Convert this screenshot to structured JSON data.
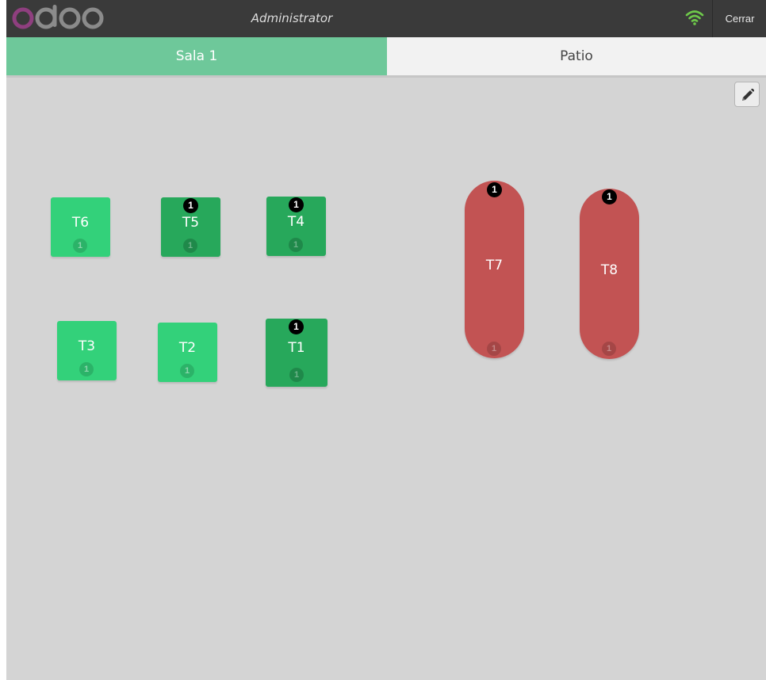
{
  "header": {
    "logo_text": "odoo",
    "user": "Administrator",
    "close_label": "Cerrar",
    "connection_icon": "wifi-icon",
    "connection_color": "#6ec84a"
  },
  "tabs": [
    {
      "label": "Sala 1",
      "active": true
    },
    {
      "label": "Patio",
      "active": false
    }
  ],
  "edit": {
    "icon": "pencil-icon"
  },
  "tables": {
    "t6": {
      "name": "T6",
      "seats": "1",
      "status": "free"
    },
    "t5": {
      "name": "T5",
      "seats": "1",
      "orders": "1",
      "status": "occupied"
    },
    "t4": {
      "name": "T4",
      "seats": "1",
      "orders": "1",
      "status": "occupied"
    },
    "t3": {
      "name": "T3",
      "seats": "1",
      "status": "free"
    },
    "t2": {
      "name": "T2",
      "seats": "1",
      "status": "free"
    },
    "t1": {
      "name": "T1",
      "seats": "1",
      "orders": "1",
      "status": "occupied"
    },
    "t7": {
      "name": "T7",
      "seats": "1",
      "orders": "1",
      "status": "occupied"
    },
    "t8": {
      "name": "T8",
      "seats": "1",
      "orders": "1",
      "status": "occupied"
    }
  },
  "colors": {
    "table_free": "#33d17a",
    "table_occupied": "#27a85b",
    "table_round": "#c25353",
    "tab_active": "#6ec89a",
    "floor": "#d4d4d4"
  }
}
